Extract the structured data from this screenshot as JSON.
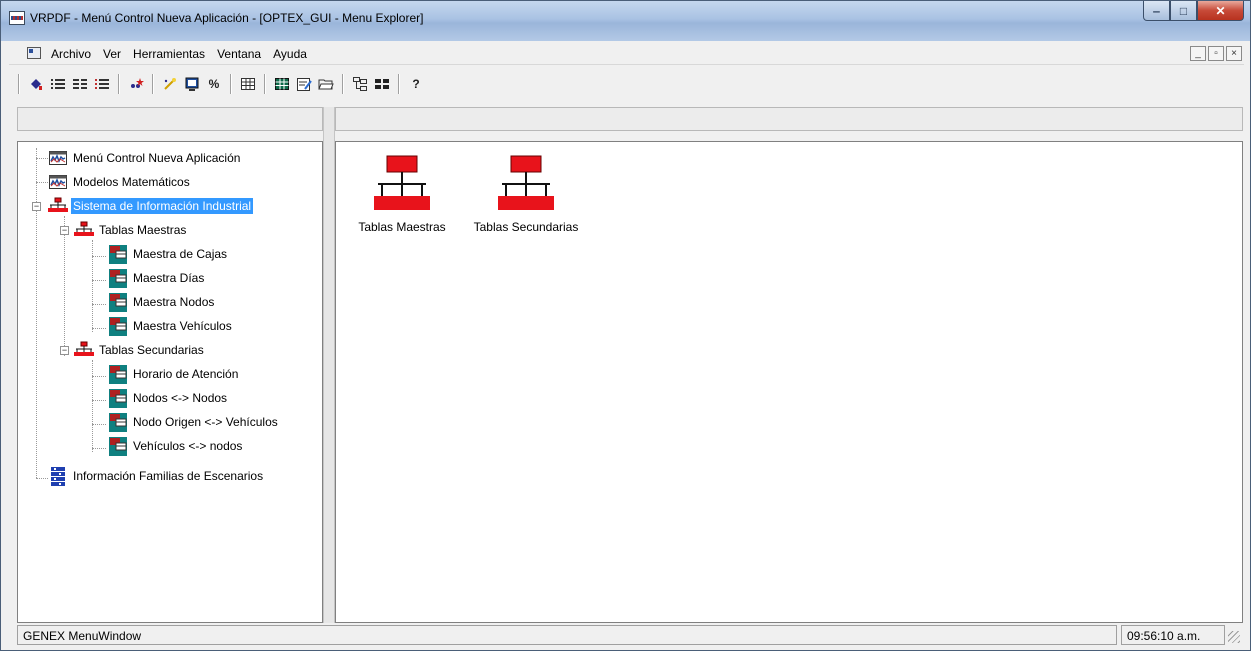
{
  "window": {
    "title": "VRPDF - Menú Control Nueva Aplicación - [OPTEX_GUI - Menu Explorer]",
    "icon": "app-icon",
    "caption_buttons": [
      "minimize",
      "maximize",
      "close"
    ]
  },
  "menubar": {
    "items": [
      "Archivo",
      "Ver",
      "Herramientas",
      "Ventana",
      "Ayuda"
    ],
    "mdi_buttons": [
      "_",
      "▫",
      "×"
    ]
  },
  "toolbar": {
    "help_label": "?",
    "percent_label": "%"
  },
  "tree": {
    "items": [
      {
        "label": "Menú Control Nueva Aplicación",
        "icon": "chart-window-icon",
        "level": 0
      },
      {
        "label": "Modelos Matemáticos",
        "icon": "chart-window-icon",
        "level": 0
      },
      {
        "label": "Sistema de Información Industrial",
        "icon": "network-icon",
        "level": 0,
        "expanded": true,
        "selected": true
      },
      {
        "label": "Tablas Maestras",
        "icon": "network-icon",
        "level": 1,
        "expanded": true
      },
      {
        "label": "Maestra de Cajas",
        "icon": "table-icon",
        "level": 2
      },
      {
        "label": "Maestra Días",
        "icon": "table-icon",
        "level": 2
      },
      {
        "label": "Maestra Nodos",
        "icon": "table-icon",
        "level": 2
      },
      {
        "label": "Maestra Vehículos",
        "icon": "table-icon",
        "level": 2
      },
      {
        "label": "Tablas Secundarias",
        "icon": "network-icon",
        "level": 1,
        "expanded": true
      },
      {
        "label": "Horario de Atención",
        "icon": "table-icon",
        "level": 2
      },
      {
        "label": "Nodos <-> Nodos",
        "icon": "table-icon",
        "level": 2
      },
      {
        "label": "Nodo Origen <-> Vehículos",
        "icon": "table-icon",
        "level": 2
      },
      {
        "label": "Vehículos <-> nodos",
        "icon": "table-icon",
        "level": 2
      },
      {
        "label": "Información Familias de Escenarios",
        "icon": "database-icon",
        "level": 0
      }
    ]
  },
  "content": {
    "items": [
      {
        "label": "Tablas Maestras",
        "icon": "network-icon"
      },
      {
        "label": "Tablas Secundarias",
        "icon": "network-icon"
      }
    ]
  },
  "statusbar": {
    "left": "GENEX MenuWindow",
    "right": "09:56:10 a.m."
  },
  "colors": {
    "selection": "#3399ff",
    "network_red": "#e8131b",
    "table_teal": "#0f8080"
  }
}
